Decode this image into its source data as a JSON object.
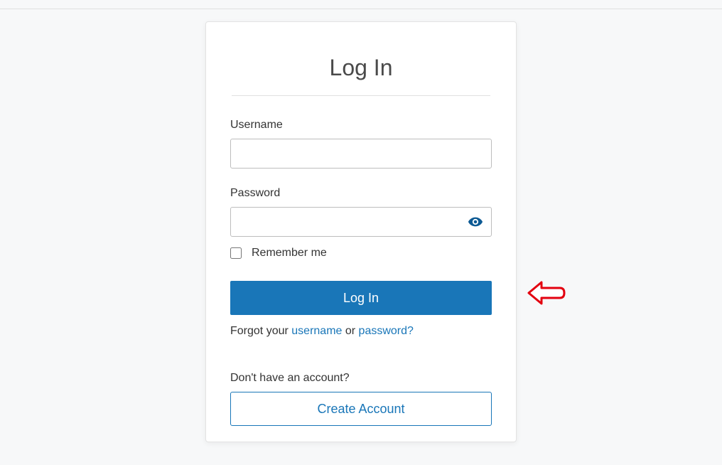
{
  "card": {
    "title": "Log In",
    "username": {
      "label": "Username",
      "value": ""
    },
    "password": {
      "label": "Password",
      "value": ""
    },
    "remember": {
      "label": "Remember me",
      "checked": false
    },
    "login_button": "Log In",
    "forgot": {
      "prefix": "Forgot your ",
      "username_link": "username",
      "middle": " or ",
      "password_link": "password?"
    },
    "no_account_label": "Don't have an account?",
    "create_button": "Create Account"
  },
  "colors": {
    "primary": "#1976b8",
    "text": "#333333",
    "border": "#bdbdbd",
    "background": "#f7f8f9"
  },
  "annotation": {
    "arrow_points_to": "login-button",
    "arrow_color": "#e3000f"
  }
}
